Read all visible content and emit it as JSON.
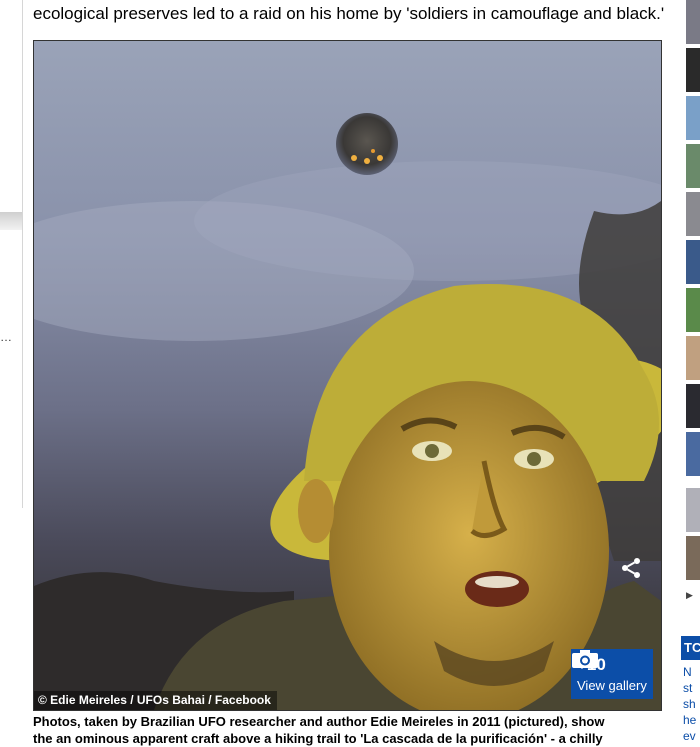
{
  "article": {
    "lead_text": "ecological preserves led to a raid on his home by 'soldiers in camouflage and black.'",
    "image_credit": "© Edie Meireles / UFOs Bahai / Facebook",
    "gallery": {
      "count": "+10",
      "label": "View gallery"
    },
    "caption_lines": [
      "Photos, taken by Brazilian UFO researcher and author Edie Meireles in 2011 (pictured), show",
      "the an ominous apparent craft above a hiking trail to 'La cascada de la purificación' - a chilly"
    ]
  },
  "left_rail": {
    "text_fragment": "…"
  },
  "right_rail": {
    "header_fragment": "TC",
    "link_fragments": [
      "N",
      "st",
      "sh",
      "he",
      "ev"
    ]
  },
  "icons": {
    "share": "share-icon",
    "camera": "camera-icon"
  },
  "colors": {
    "gallery_blue": "#0c4ea8"
  }
}
